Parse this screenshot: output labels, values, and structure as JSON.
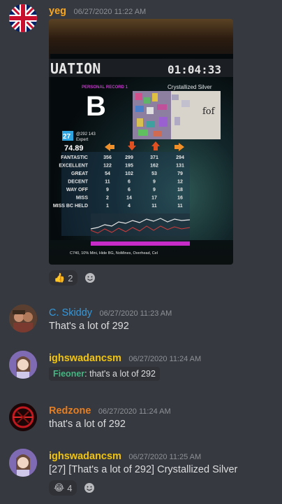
{
  "messages": [
    {
      "username": "yeg",
      "username_color": "#faa61a",
      "timestamp": "06/27/2020 11:22 AM",
      "avatar": "uk-flag-avatar",
      "screenshot": {
        "title_fragment": "UATION",
        "timer": "01:04:33",
        "personal_record_label": "PERSONAL RECORD 1",
        "song_name": "Crystallized Silver",
        "grade": "B",
        "jacket_text": "fof",
        "difficulty_level": "27",
        "bpm": "@292 143",
        "difficulty_name": "Expert",
        "score": "74.89",
        "rows": [
          {
            "label": "FANTASTIC",
            "values": [
              "356",
              "299",
              "371",
              "294"
            ]
          },
          {
            "label": "EXCELLENT",
            "values": [
              "122",
              "195",
              "162",
              "131"
            ]
          },
          {
            "label": "GREAT",
            "values": [
              "54",
              "102",
              "53",
              "79"
            ]
          },
          {
            "label": "DECENT",
            "values": [
              "11",
              "6",
              "9",
              "12"
            ]
          },
          {
            "label": "WAY OFF",
            "values": [
              "9",
              "6",
              "9",
              "18"
            ]
          },
          {
            "label": "MISS",
            "values": [
              "2",
              "14",
              "17",
              "16"
            ]
          },
          {
            "label": "MISS BC HELD",
            "values": [
              "1",
              "4",
              "11",
              "11"
            ]
          }
        ],
        "modifiers": "C740, 10% Mini, Hide BG, NoMines, Overhead, Cel"
      },
      "reactions": [
        {
          "emoji": "👍",
          "count": "2"
        }
      ]
    },
    {
      "username": "C. Skiddy",
      "username_color": "#3498db",
      "timestamp": "06/27/2020 11:23 AM",
      "text": "That's a lot of 292"
    },
    {
      "username": "ighswadancsm",
      "username_color": "#f1c40f",
      "timestamp": "06/27/2020 11:24 AM",
      "chip_user": "Fieoner",
      "chip_text": ": that's a lot of 292"
    },
    {
      "username": "Redzone",
      "username_color": "#e67e22",
      "timestamp": "06/27/2020 11:24 AM",
      "text": "that's a lot of 292"
    },
    {
      "username": "ighswadancsm",
      "username_color": "#f1c40f",
      "timestamp": "06/27/2020 11:25 AM",
      "text": "[27] [That's a lot of 292] Crystallized Silver",
      "reactions": [
        {
          "emoji": "😂",
          "count": "4"
        }
      ]
    }
  ]
}
